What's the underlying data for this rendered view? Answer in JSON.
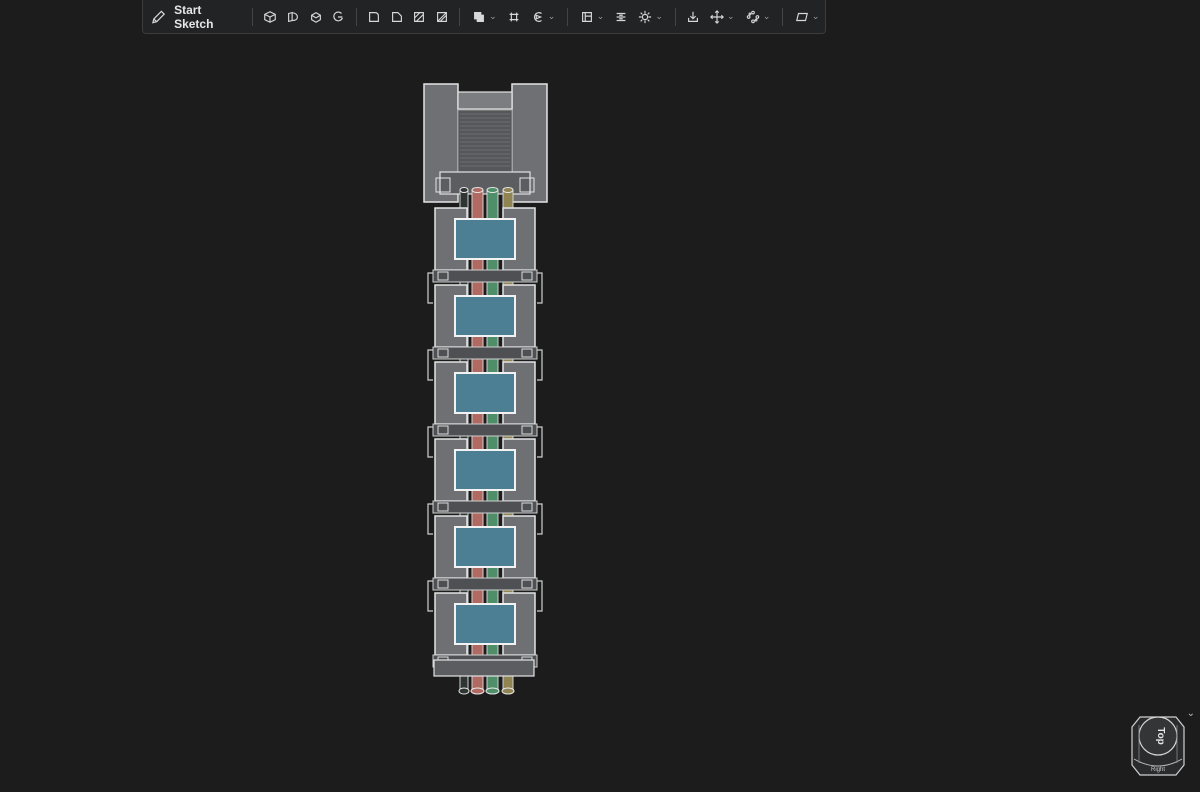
{
  "toolbar": {
    "start_sketch_label": "Start Sketch",
    "icons": [
      "pencil-icon",
      "box-icon",
      "revolve-icon",
      "sweep-icon",
      "loft-icon",
      "fillet-icon",
      "chamfer-icon",
      "shell-icon",
      "draft-icon",
      "boolean-icon",
      "plane-icon",
      "pattern-rotate-icon",
      "sketch-plane-icon",
      "list-icon",
      "gear-icon",
      "import-icon",
      "move-icon",
      "points-icon",
      "parallelogram-icon"
    ]
  },
  "viewcube": {
    "top_label": "Top",
    "right_label": "Right"
  },
  "colors": {
    "background": "#1c1c1c",
    "part_gray": "#6e7074",
    "panel_teal": "#4d7f94",
    "tube_red": "#b06a62",
    "tube_green": "#4e8f6a",
    "tube_olive": "#8f8452",
    "tube_dark": "#2e3532"
  }
}
